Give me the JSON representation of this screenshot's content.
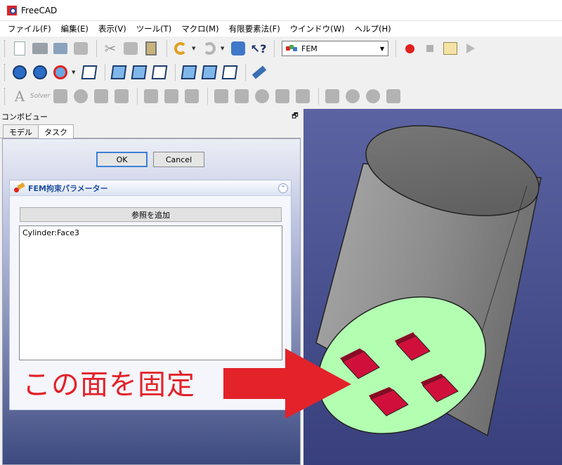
{
  "window": {
    "title": "FreeCAD"
  },
  "menu": [
    "ファイル(F)",
    "編集(E)",
    "表示(V)",
    "ツール(T)",
    "マクロ(M)",
    "有限要素法(F)",
    "ウインドウ(W)",
    "ヘルプ(H)"
  ],
  "toolbar": {
    "workbench": "FEM"
  },
  "toolbar3": {
    "solver_label": "Solver"
  },
  "combo_view": {
    "title": "コンボビュー",
    "tabs": [
      "モデル",
      "タスク"
    ],
    "active_tab": "タスク"
  },
  "task": {
    "ok_label": "OK",
    "cancel_label": "Cancel",
    "panel_title": "FEM拘束パラメーター",
    "add_reference_label": "参照を追加",
    "references": [
      "Cylinder:Face3"
    ]
  },
  "annotation": {
    "text": "この面を固定",
    "color": "#e3222a"
  },
  "colors": {
    "selected_face": "#b2ffb2",
    "pocket": "#d0103a",
    "cylinder": "#8f8f8f",
    "viewport_top": "#5b63a2",
    "viewport_bottom": "#383f7c"
  }
}
